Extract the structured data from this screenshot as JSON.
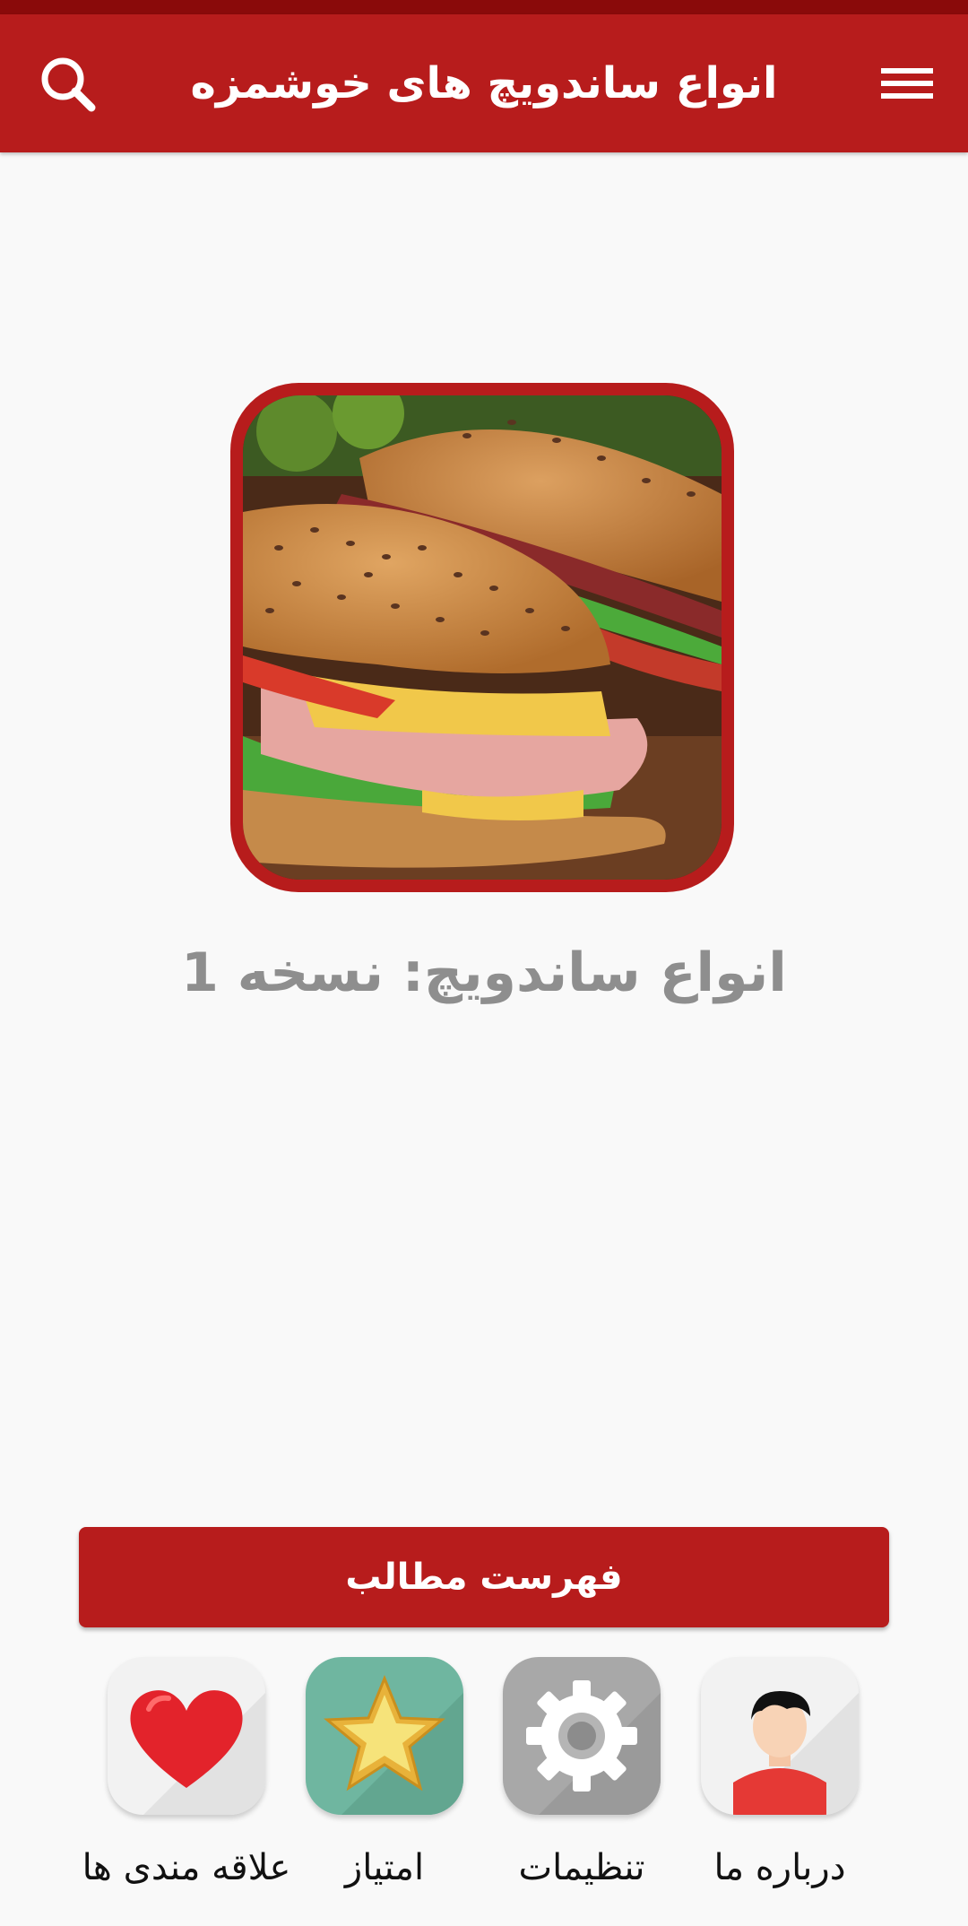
{
  "app_bar": {
    "title": "انواع ساندویچ های خوشمزه",
    "menu_icon": "hamburger-menu-icon",
    "search_icon": "search-icon"
  },
  "hero": {
    "image": "sandwich-illustration"
  },
  "version_text": "انواع ساندویچ: نسخه 1",
  "contents_button": "فهرست مطالب",
  "tiles": [
    {
      "label": "درباره ما",
      "icon": "user-avatar-icon"
    },
    {
      "label": "تنظیمات",
      "icon": "gear-icon"
    },
    {
      "label": "امتیاز",
      "icon": "star-icon"
    },
    {
      "label": "علاقه مندی ها",
      "icon": "heart-icon"
    }
  ],
  "colors": {
    "primary": "#b71c1c",
    "status_bar": "#8a0a0a",
    "background": "#f9f9f9",
    "version_text": "#8e8e8e",
    "star_tile": "#6fb6a0",
    "gear_tile": "#a8a8a8"
  }
}
